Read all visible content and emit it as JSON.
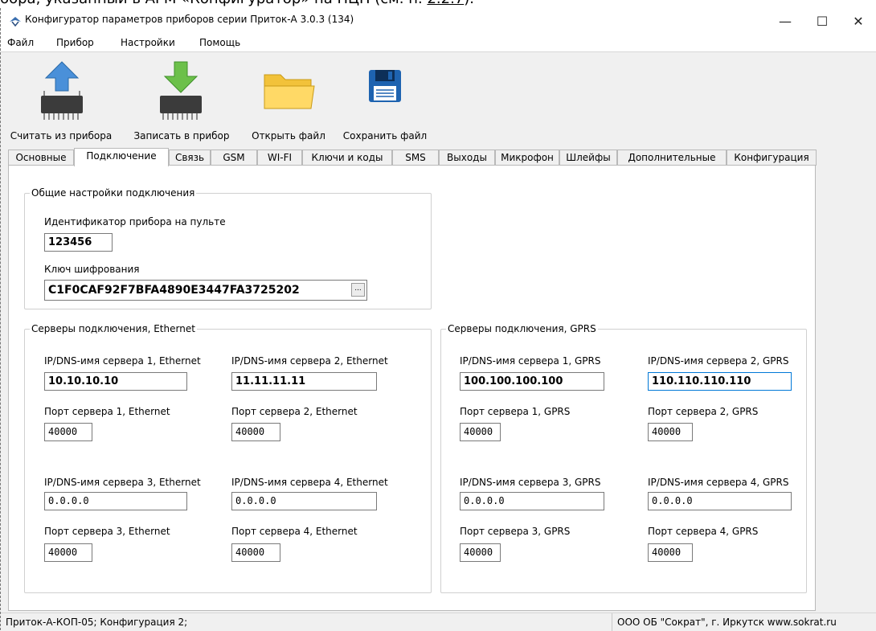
{
  "page_remnant": {
    "text_before": "бора, указанный в АРМ «Конфигуратор» на ПЦН (см. п.",
    "link": "2.2.7",
    "text_after": ")."
  },
  "window": {
    "title": "Конфигуратор параметров приборов серии Приток-А  3.0.3 (134)",
    "controls": {
      "minimize": "—",
      "maximize": "☐",
      "close": "✕"
    }
  },
  "menu": [
    "Файл",
    "Прибор",
    "Настройки",
    "Помощь"
  ],
  "toolbar": {
    "read": "Считать из прибора",
    "write": "Записать в прибор",
    "open": "Открыть файл",
    "save": "Сохранить файл"
  },
  "tabs": [
    "Основные",
    "Подключение",
    "Связь",
    "GSM",
    "WI-FI",
    "Ключи и коды",
    "SMS",
    "Выходы",
    "Микрофон",
    "Шлейфы",
    "Дополнительные",
    "Конфигурация"
  ],
  "active_tab": "Подключение",
  "general": {
    "legend": "Общие настройки подключения",
    "id_label": "Идентификатор прибора на пульте",
    "id_value": "123456",
    "key_label": "Ключ шифрования",
    "key_value": "C1F0CAF92F7BFA4890E3447FA3725202",
    "key_button": "..."
  },
  "ethernet": {
    "legend": "Серверы подключения, Ethernet",
    "servers": [
      {
        "ip_label": "IP/DNS-имя сервера 1, Ethernet",
        "ip": "10.10.10.10",
        "port_label": "Порт сервера 1, Ethernet",
        "port": "40000"
      },
      {
        "ip_label": "IP/DNS-имя сервера 2, Ethernet",
        "ip": "11.11.11.11",
        "port_label": "Порт сервера 2, Ethernet",
        "port": "40000"
      },
      {
        "ip_label": "IP/DNS-имя сервера 3, Ethernet",
        "ip": "0.0.0.0",
        "port_label": "Порт сервера 3, Ethernet",
        "port": "40000"
      },
      {
        "ip_label": "IP/DNS-имя сервера 4, Ethernet",
        "ip": "0.0.0.0",
        "port_label": "Порт сервера 4, Ethernet",
        "port": "40000"
      }
    ]
  },
  "gprs": {
    "legend": "Серверы подключения, GPRS",
    "servers": [
      {
        "ip_label": "IP/DNS-имя сервера 1, GPRS",
        "ip": "100.100.100.100",
        "port_label": "Порт сервера 1, GPRS",
        "port": "40000"
      },
      {
        "ip_label": "IP/DNS-имя сервера 2, GPRS",
        "ip": "110.110.110.110",
        "port_label": "Порт сервера 2, GPRS",
        "port": "40000"
      },
      {
        "ip_label": "IP/DNS-имя сервера 3, GPRS",
        "ip": "0.0.0.0",
        "port_label": "Порт сервера 3, GPRS",
        "port": "40000"
      },
      {
        "ip_label": "IP/DNS-имя сервера 4, GPRS",
        "ip": "0.0.0.0",
        "port_label": "Порт сервера 4, GPRS",
        "port": "40000"
      }
    ]
  },
  "status": {
    "left": "Приток-А-КОП-05; Конфигурация 2;",
    "right": "ООО ОБ \"Сократ\", г. Иркутск   www.sokrat.ru"
  },
  "colors": {
    "focus_border": "#0078d7",
    "window_bg": "#f0f0f0"
  }
}
